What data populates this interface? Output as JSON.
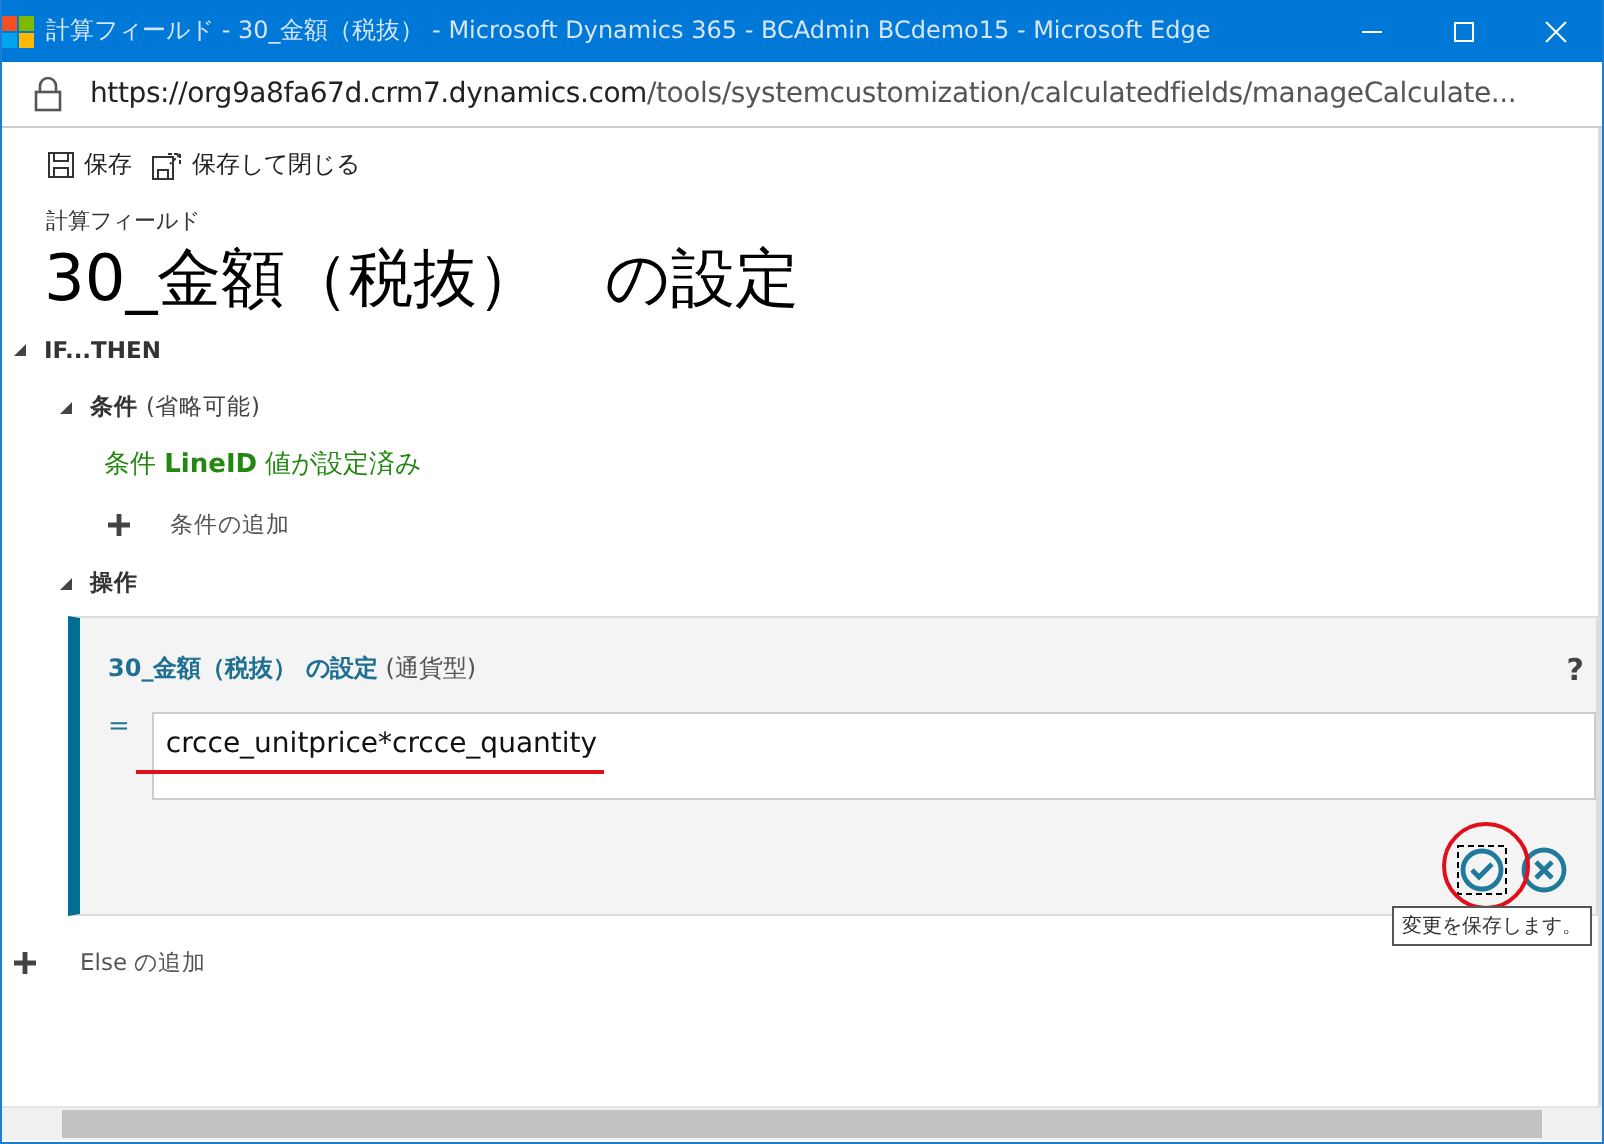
{
  "window": {
    "title": "計算フィールド - 30_金額（税抜） - Microsoft Dynamics 365 - BCAdmin BCdemo15 - Microsoft Edge"
  },
  "address_bar": {
    "url_host": "https://org9a8fa67d.crm7.dynamics.com",
    "url_path": "/tools/systemcustomization/calculatedfields/manageCalculate..."
  },
  "toolbar": [
    {
      "label": "保存",
      "kind": "save"
    },
    {
      "label": "保存して閉じる",
      "kind": "save-close"
    }
  ],
  "subtitle": "計算フィールド",
  "heading": "30_金額（税抜）　の設定",
  "tree": {
    "label": "IF...THEN",
    "expanded": true,
    "children": [
      {
        "kind": "condition",
        "label": "条件",
        "hint": "(省略可能)",
        "expanded": true,
        "condition": "条件 **LineID** 値が設定済み",
        "add_label": "条件の追加"
      },
      {
        "kind": "action",
        "label": "操作",
        "expanded": true,
        "action_title": "**30_金額（税抜） の設定** (通貨型)",
        "help": "?",
        "equals": "=",
        "formula": "crcce_unitprice*crcce_quantity",
        "tooltip": "変更を保存します。"
      }
    ]
  },
  "else_add": "Else の追加"
}
